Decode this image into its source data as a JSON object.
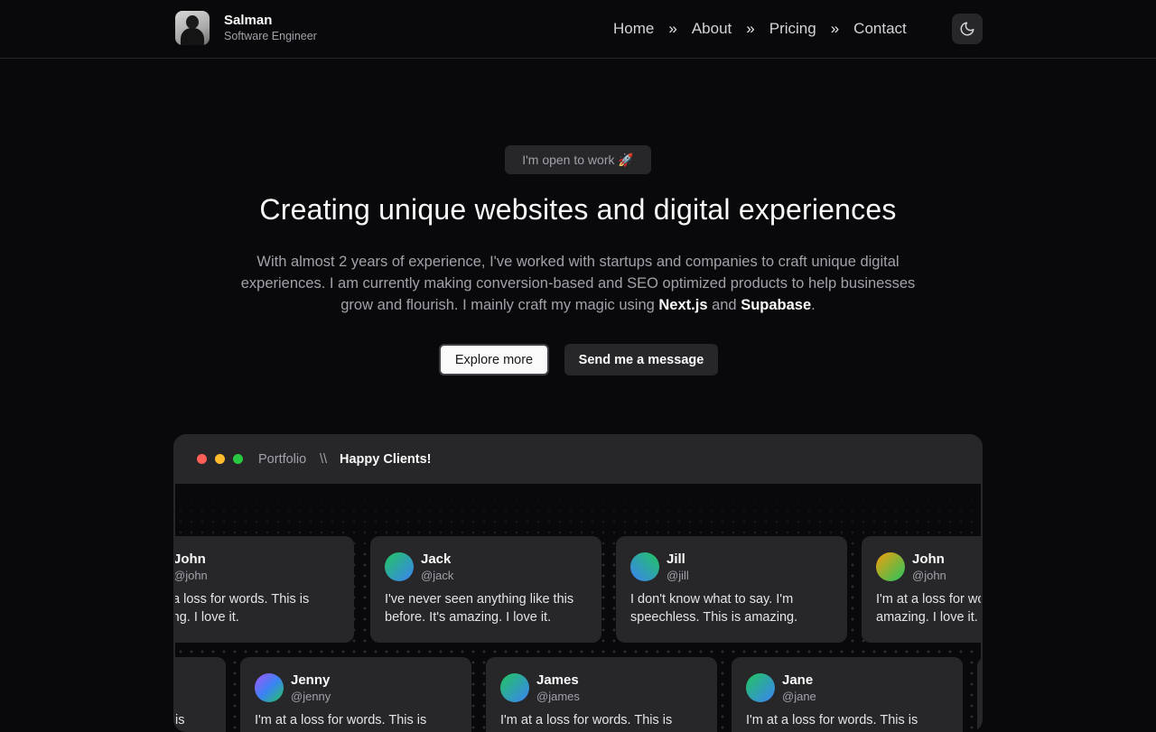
{
  "header": {
    "name": "Salman",
    "role": "Software Engineer",
    "nav": [
      "Home",
      "About",
      "Pricing",
      "Contact"
    ],
    "separator": "»"
  },
  "hero": {
    "badge": "I'm open to work 🚀",
    "title": "Creating unique websites and digital experiences",
    "description_prefix": "With almost 2 years of experience, I've worked with startups and companies to craft unique digital experiences. I am currently making conversion-based and SEO optimized products to help businesses grow and flourish. I mainly craft my magic using ",
    "tech_1": "Next.js",
    "and": " and ",
    "tech_2": "Supabase",
    "period": ".",
    "explore_label": "Explore more",
    "message_label": "Send me a message"
  },
  "window": {
    "crumb_1": "Portfolio",
    "crumb_sep": "\\\\",
    "crumb_2": "Happy Clients!"
  },
  "testimonials": {
    "row1": [
      {
        "name": "John",
        "handle": "@john",
        "text": "I'm at a loss for words. This is amazing. I love it."
      },
      {
        "name": "Jack",
        "handle": "@jack",
        "text": "I've never seen anything like this before. It's amazing. I love it."
      },
      {
        "name": "Jill",
        "handle": "@jill",
        "text": "I don't know what to say. I'm speechless. This is amazing."
      },
      {
        "name": "John",
        "handle": "@john",
        "text": "I'm at a loss for words. This is amazing. I love it."
      }
    ],
    "row2": [
      {
        "name": "",
        "handle": "",
        "text": "is"
      },
      {
        "name": "Jenny",
        "handle": "@jenny",
        "text": "I'm at a loss for words. This is amazing. I love it."
      },
      {
        "name": "James",
        "handle": "@james",
        "text": "I'm at a loss for words. This is amazing. I love it."
      },
      {
        "name": "Jane",
        "handle": "@jane",
        "text": "I'm at a loss for words. This is amazing. I love it."
      }
    ]
  },
  "colors": {
    "background": "#09090b",
    "surface": "#27272a",
    "dot_red": "#ff5f57",
    "dot_yellow": "#febc2e",
    "dot_green": "#28c840"
  }
}
